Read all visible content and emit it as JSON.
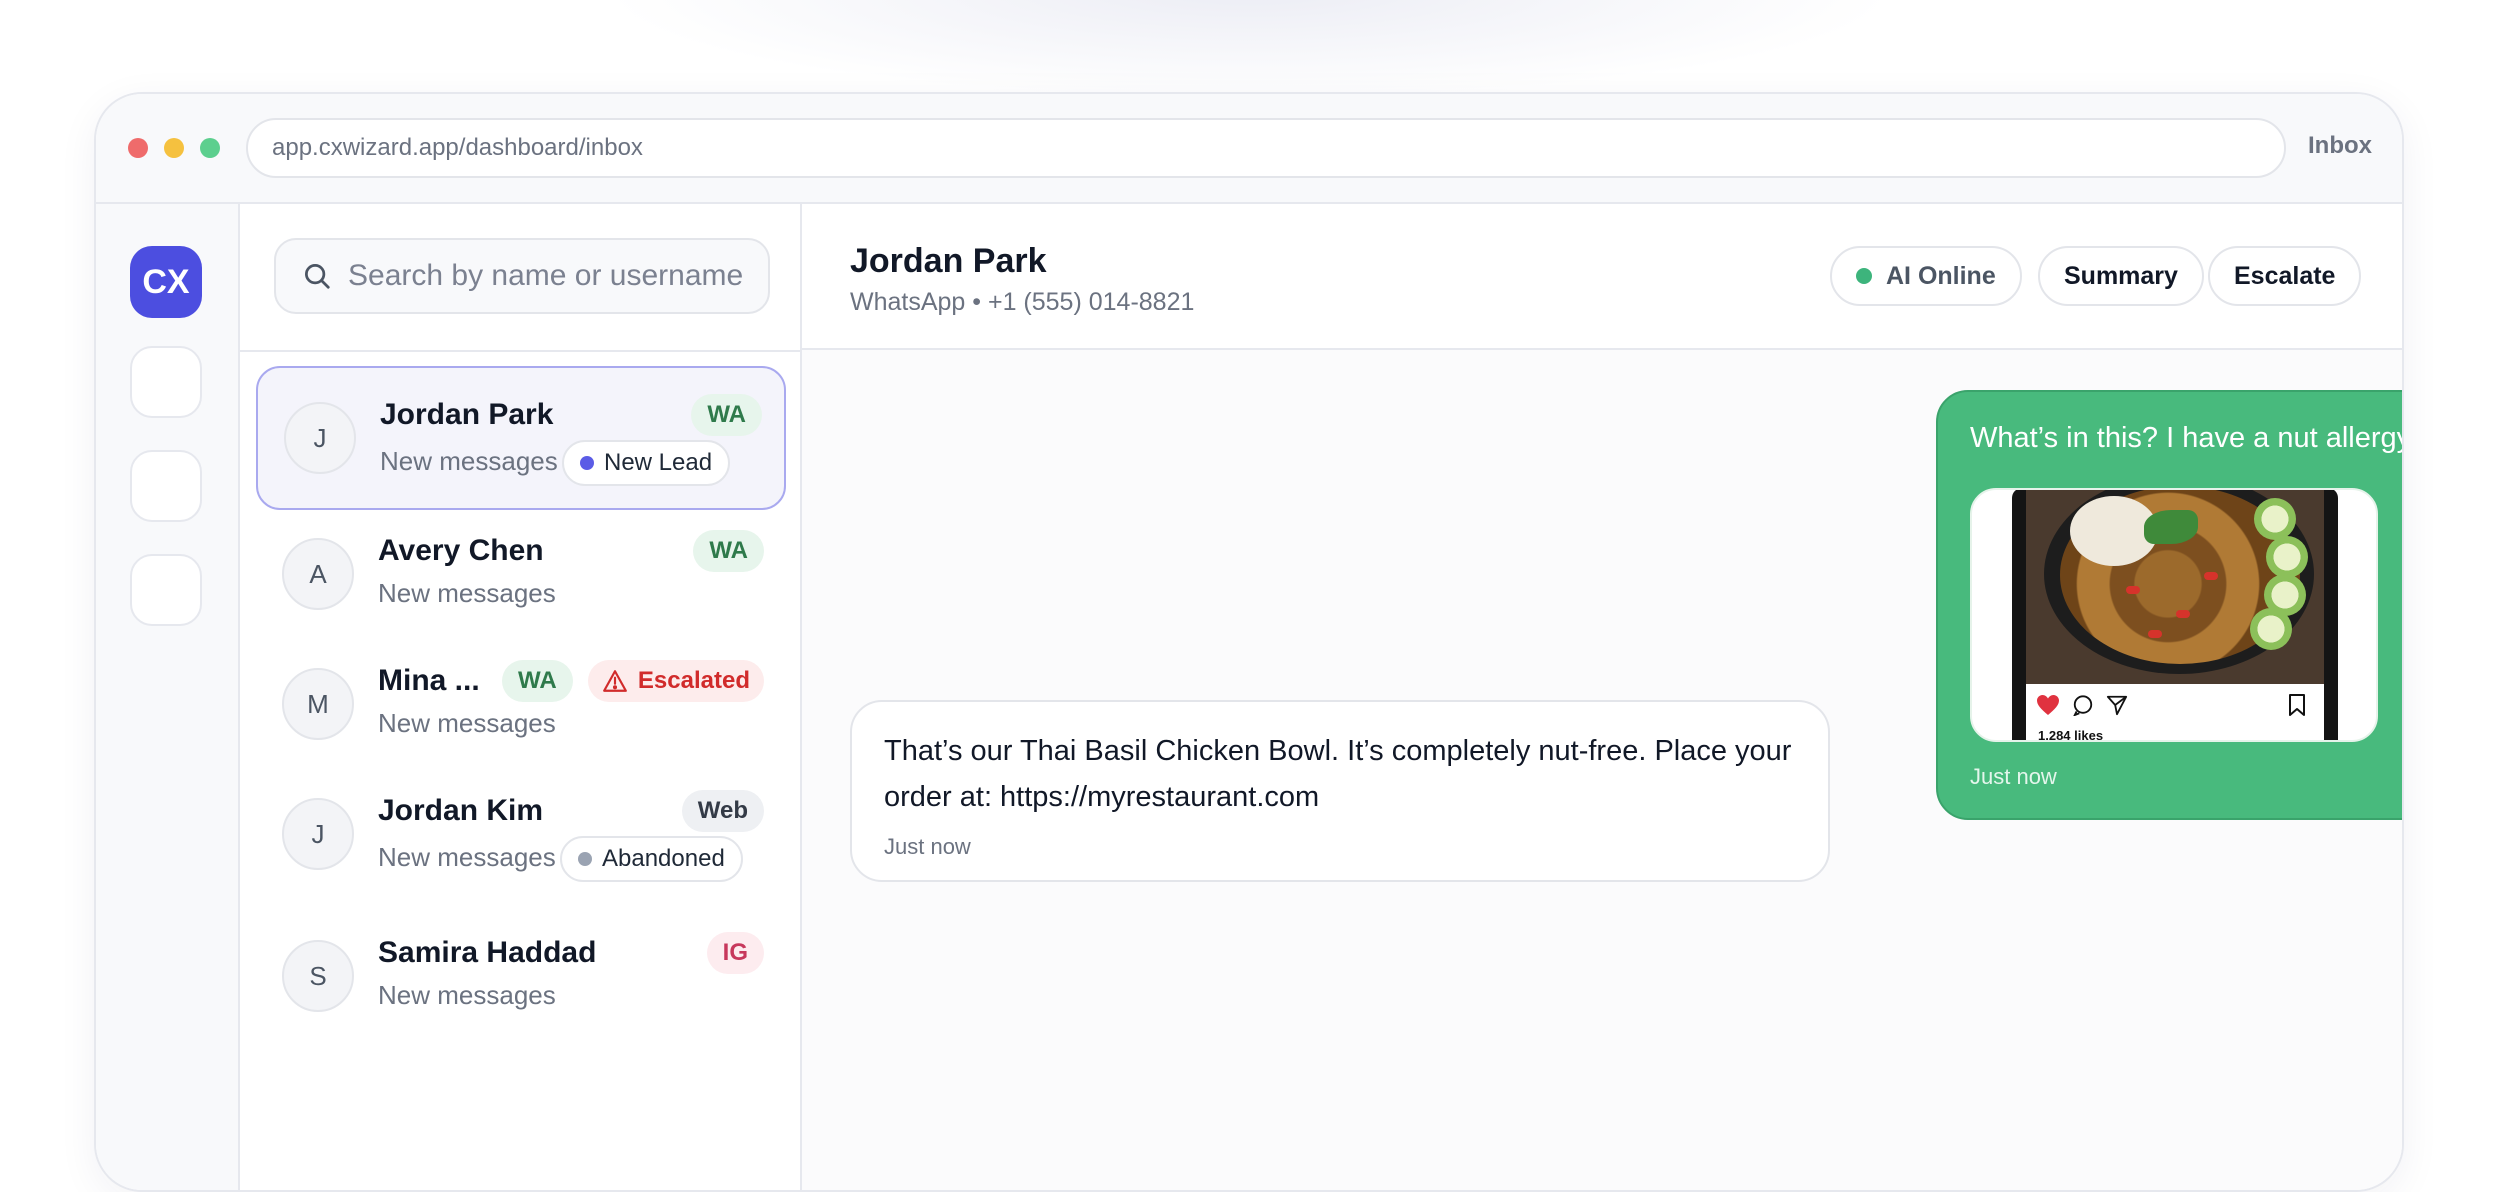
{
  "browser": {
    "url": "app.cxwizard.app/dashboard/inbox",
    "label": "Inbox"
  },
  "rail": {
    "logo": "CX"
  },
  "search": {
    "placeholder": "Search by name or username"
  },
  "conversations": [
    {
      "initial": "J",
      "name": "Jordan Park",
      "preview": "New messages",
      "channel": "WA",
      "tag": "New Lead",
      "tag_color": "#5b5ce6"
    },
    {
      "initial": "A",
      "name": "Avery Chen",
      "preview": "New messages",
      "channel": "WA"
    },
    {
      "initial": "M",
      "name": "Mina ...",
      "preview": "New messages",
      "channel": "WA",
      "status": "Escalated"
    },
    {
      "initial": "J",
      "name": "Jordan Kim",
      "preview": "New messages",
      "channel": "Web",
      "tag": "Abandoned",
      "tag_color": "#9aa3b2"
    },
    {
      "initial": "S",
      "name": "Samira Haddad",
      "preview": "New messages",
      "channel": "IG"
    }
  ],
  "chat": {
    "name": "Jordan Park",
    "meta": "WhatsApp • +1 (555) 014-8821",
    "buttons": {
      "ai_status": "AI Online",
      "summary": "Summary",
      "escalate": "Escalate"
    },
    "messages": [
      {
        "direction": "outgoing",
        "text": "What’s in this? I have a nut allergy",
        "time": "Just now",
        "attachment": {
          "likes": "1,284 likes"
        }
      },
      {
        "direction": "incoming",
        "text": "That’s our Thai Basil Chicken Bowl. It’s completely nut-free. Place your order at: https://myrestaurant.com",
        "time": "Just now"
      }
    ]
  },
  "colors": {
    "brand": "#4c4ee0",
    "outgoing_bubble": "#48ba7d",
    "ai_online": "#3db47c",
    "escalated": "#d12b2b"
  }
}
